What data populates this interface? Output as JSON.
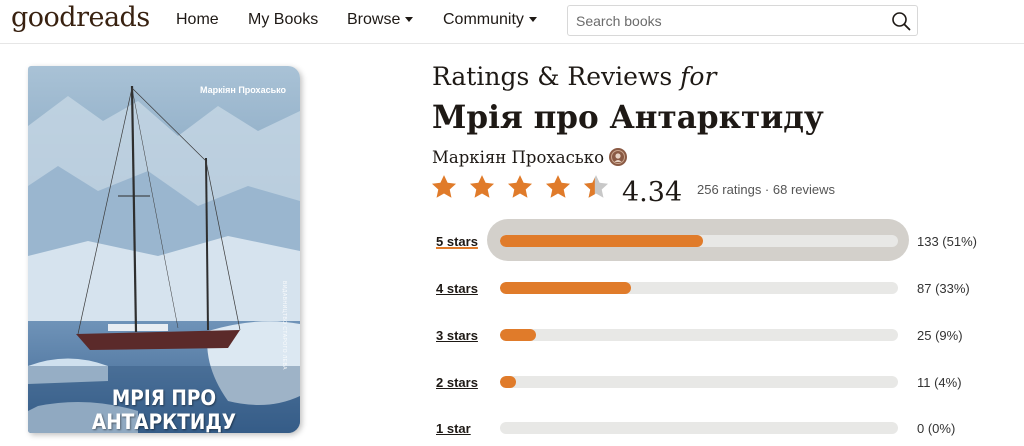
{
  "header": {
    "logo": "goodreads",
    "nav": {
      "home": "Home",
      "my_books": "My Books",
      "browse": "Browse",
      "community": "Community"
    },
    "search_placeholder": "Search books"
  },
  "cover": {
    "author": "Маркіян Прохасько",
    "title": "МРІЯ ПРО АНТАРКТИДУ",
    "publisher": "ВИДАВНИЦТВО СТАРОГО ЛЕВА"
  },
  "ratings": {
    "heading_prefix": "Ratings & Reviews ",
    "heading_for": "for",
    "book_title": "Мрія про Антарктиду",
    "author": "Маркіян Прохасько",
    "average": "4.34",
    "average_value": 4.34,
    "meta": "256 ratings · 68 reviews",
    "star_color": "#e07b2a",
    "histogram": [
      {
        "label": "5 stars",
        "count": "133 (51%)",
        "percent": 51
      },
      {
        "label": "4 stars",
        "count": "87 (33%)",
        "percent": 33
      },
      {
        "label": "3 stars",
        "count": "25 (9%)",
        "percent": 9
      },
      {
        "label": "2 stars",
        "count": "11 (4%)",
        "percent": 4
      },
      {
        "label": "1 star",
        "count": "0 (0%)",
        "percent": 0
      }
    ]
  }
}
